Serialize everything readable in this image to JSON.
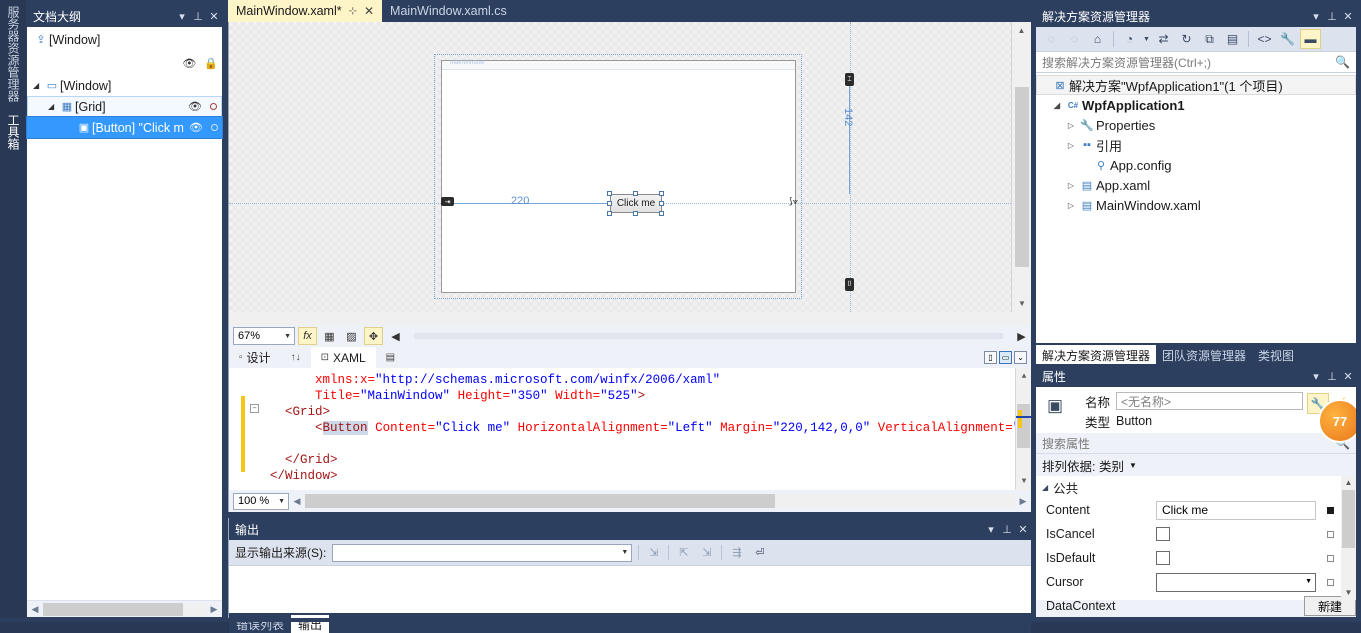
{
  "vertical_tabs": [
    {
      "label": "服务器资源管理器",
      "selected": false
    },
    {
      "label": "工具箱",
      "selected": true
    }
  ],
  "document_outline": {
    "title": "文档大纲",
    "buttons": {
      "dropdown": "▾",
      "pin": "⊥",
      "close": "✕"
    },
    "breadcrumb": "[Window]",
    "tree": [
      {
        "label": "[Window]",
        "indent": 1,
        "arrow": "◢",
        "icon": "▭",
        "selected": false,
        "eye": false
      },
      {
        "label": "[Grid]",
        "indent": 2,
        "arrow": "◢",
        "icon": "▦",
        "selected": false,
        "eye": true
      },
      {
        "label": "[Button] \"Click m",
        "indent": 3,
        "arrow": "",
        "icon": "▣",
        "selected": true,
        "eye": true
      }
    ]
  },
  "editor_tabs": [
    {
      "label": "MainWindow.xaml*",
      "active": true,
      "pin": "⊹",
      "close": "✕"
    },
    {
      "label": "MainWindow.xaml.cs",
      "active": false
    }
  ],
  "designer": {
    "window_title": "MainWindow",
    "button_label": "Click me",
    "measure_horizontal": "220",
    "measure_vertical": "142",
    "zoom": "67%",
    "toolbar_icons": [
      "fx",
      "grid-icon",
      "snap-icon",
      "artboard-icon",
      "collapse-icon"
    ]
  },
  "split_tabs": {
    "design_label": "设计",
    "swap_icon": "↑↓",
    "xaml_label": "XAML",
    "extra_icon": "▤"
  },
  "code": {
    "zoom": "100 %",
    "lines": [
      {
        "indent": 8,
        "parts": [
          {
            "t": "xmlns:x=",
            "c": "attr"
          },
          {
            "t": "\"http://schemas.microsoft.com/winfx/2006/xaml\"",
            "c": "val"
          }
        ]
      },
      {
        "indent": 8,
        "parts": [
          {
            "t": "Title=",
            "c": "attr"
          },
          {
            "t": "\"MainWindow\"",
            "c": "val"
          },
          {
            "t": " ",
            "c": "plain"
          },
          {
            "t": "Height=",
            "c": "attr"
          },
          {
            "t": "\"350\"",
            "c": "val"
          },
          {
            "t": " ",
            "c": "plain"
          },
          {
            "t": "Width=",
            "c": "attr"
          },
          {
            "t": "\"525\"",
            "c": "val"
          },
          {
            "t": ">",
            "c": "tag"
          }
        ]
      },
      {
        "indent": 4,
        "parts": [
          {
            "t": "<Grid>",
            "c": "tag"
          }
        ]
      },
      {
        "indent": 8,
        "parts": [
          {
            "t": "<",
            "c": "tag"
          },
          {
            "t": "Button",
            "c": "selected-tag"
          },
          {
            "t": " ",
            "c": "plain"
          },
          {
            "t": "Content=",
            "c": "attr"
          },
          {
            "t": "\"Click me\"",
            "c": "val"
          },
          {
            "t": " ",
            "c": "plain"
          },
          {
            "t": "HorizontalAlignment=",
            "c": "attr"
          },
          {
            "t": "\"Left\"",
            "c": "val"
          },
          {
            "t": " ",
            "c": "plain"
          },
          {
            "t": "Margin=",
            "c": "attr"
          },
          {
            "t": "\"220,142,0,0\"",
            "c": "val"
          },
          {
            "t": " ",
            "c": "plain"
          },
          {
            "t": "VerticalAlignment=",
            "c": "attr"
          },
          {
            "t": "\"Top\"",
            "c": "val"
          }
        ]
      },
      {
        "indent": 0,
        "parts": []
      },
      {
        "indent": 4,
        "parts": [
          {
            "t": "</Grid>",
            "c": "tag"
          }
        ]
      },
      {
        "indent": 2,
        "parts": [
          {
            "t": "</Window>",
            "c": "tag"
          }
        ]
      }
    ]
  },
  "output_panel": {
    "title": "输出",
    "buttons": {
      "dropdown": "▾",
      "pin": "⊥",
      "close": "✕"
    },
    "source_label": "显示输出来源(S):",
    "source_value": "",
    "toolbar_icons": [
      "find-icon",
      "clear-icon",
      "wrap-icon",
      "goto-icon",
      "wordwrap-icon"
    ],
    "tabs": [
      {
        "label": "错误列表",
        "active": false
      },
      {
        "label": "输出",
        "active": true
      }
    ]
  },
  "solution_explorer": {
    "title": "解决方案资源管理器",
    "buttons": {
      "dropdown": "▾",
      "pin": "⊥",
      "close": "✕"
    },
    "toolbar_icons": [
      "back-icon",
      "forward-icon",
      "home-icon",
      "pending-changes-icon",
      "sync-icon",
      "refresh-icon",
      "collapse-all-icon",
      "properties-icon",
      "show-all-files-icon",
      "wrench-icon",
      "preview-icon"
    ],
    "search_placeholder": "搜索解决方案资源管理器(Ctrl+;)",
    "tree": [
      {
        "label": "解决方案\"WpfApplication1\"(1 个项目)",
        "indent": 0,
        "tri": "",
        "icon": "⊠",
        "bold": false,
        "solution": true
      },
      {
        "label": "WpfApplication1",
        "indent": 1,
        "tri": "◢",
        "icon": "C#",
        "bold": true,
        "solution": false
      },
      {
        "label": "Properties",
        "indent": 2,
        "tri": "▷",
        "icon": "🔧",
        "bold": false,
        "solution": false
      },
      {
        "label": "引用",
        "indent": 2,
        "tri": "▷",
        "icon": "▪▪",
        "bold": false,
        "solution": false
      },
      {
        "label": "App.config",
        "indent": 3,
        "tri": "",
        "icon": "⚲",
        "bold": false,
        "solution": false
      },
      {
        "label": "App.xaml",
        "indent": 2,
        "tri": "▷",
        "icon": "▤",
        "bold": false,
        "solution": false
      },
      {
        "label": "MainWindow.xaml",
        "indent": 2,
        "tri": "▷",
        "icon": "▤",
        "bold": false,
        "solution": false
      }
    ],
    "tabs": [
      {
        "label": "解决方案资源管理器",
        "active": true
      },
      {
        "label": "团队资源管理器",
        "active": false
      },
      {
        "label": "类视图",
        "active": false
      }
    ]
  },
  "properties": {
    "title": "属性",
    "buttons": {
      "dropdown": "▾",
      "pin": "⊥",
      "close": "✕"
    },
    "name_label": "名称",
    "name_value": "<无名称>",
    "type_label": "类型",
    "type_value": "Button",
    "search_placeholder": "搜索属性",
    "sort_label": "排列依据: 类别",
    "category": "公共",
    "badge_text": "77",
    "rows": [
      {
        "name": "Content",
        "editor": "text",
        "value": "Click me",
        "mark": "filled"
      },
      {
        "name": "IsCancel",
        "editor": "checkbox",
        "value": "",
        "mark": "empty"
      },
      {
        "name": "IsDefault",
        "editor": "checkbox",
        "value": "",
        "mark": "empty"
      },
      {
        "name": "Cursor",
        "editor": "combo",
        "value": "",
        "mark": "empty"
      },
      {
        "name": "DataContext",
        "editor": "button",
        "value": "新建",
        "mark": "empty"
      }
    ]
  }
}
